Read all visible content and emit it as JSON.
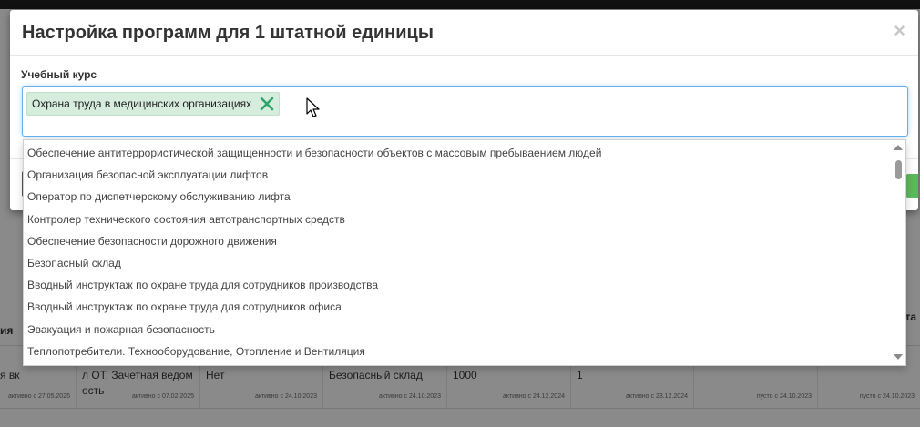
{
  "modal": {
    "title": "Настройка программ для 1 штатной единицы",
    "close_glyph": "×",
    "field_label": "Учебный курс",
    "selected_chip": "Охрана труда в медицинских организациях"
  },
  "dropdown": {
    "options": [
      "Обеспечение антитеррористической защищенности и безопасности объектов с массовым пребываением людей",
      "Организация безопасной эксплуатации лифтов",
      "Оператор по диспетчерскому обслуживанию лифта",
      "Контролер технического состояния автотранспортных средств",
      "Обеспечение безопасности дорожного движения",
      "Безопасный склад",
      "Вводный инструктаж по охране труда для сотрудников производства",
      "Вводный инструктаж по охране труда для сотрудников офиса",
      "Эвакуация и пожарная безопасность",
      "Теплопотребители. Технооборудование, Отопление и Вентиляция"
    ]
  },
  "background_table": {
    "header_left": "ия",
    "header_right": "та",
    "row": [
      {
        "text": "я вк",
        "status": "активно с 27.05.2025"
      },
      {
        "text": "л ОТ, Зачетная ведом ость",
        "status": "активно с 07.02.2025"
      },
      {
        "text": "Нет",
        "status": "активно с 24.10.2023"
      },
      {
        "text": "Безопасный склад",
        "status": "активно с 24.10.2023"
      },
      {
        "text": "1000",
        "status": "активно с 24.12.2024"
      },
      {
        "text": "1",
        "status": "активно с 23.12.2024"
      },
      {
        "text": "",
        "status": "пусто с 24.10.2023"
      },
      {
        "text": "",
        "status": "пусто с 24.10.2023"
      }
    ]
  },
  "colors": {
    "accent_focus": "#66afe9",
    "chip_bg": "#d6ecdc",
    "chip_remove": "#2fa36a",
    "primary_green": "#5cb85c"
  }
}
